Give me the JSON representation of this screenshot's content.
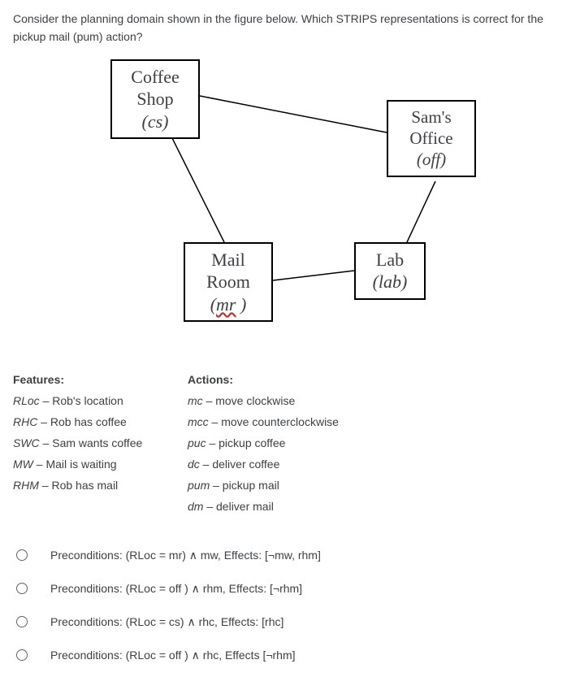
{
  "question": "Consider the planning domain shown in the figure below. Which STRIPS representations is correct for the pickup mail (pum) action?",
  "nodes": {
    "coffee": {
      "line1": "Coffee",
      "line2": "Shop",
      "line3": "(cs)"
    },
    "sam": {
      "line1": "Sam's",
      "line2": "Office",
      "line3": "(off)"
    },
    "mail": {
      "line1": "Mail",
      "line2": "Room",
      "line3_prefix": "(",
      "line3_mr": "mr",
      "line3_suffix": " )"
    },
    "lab": {
      "line1": "Lab",
      "line2": "(lab)"
    }
  },
  "features": {
    "heading": "Features:",
    "items": [
      {
        "abbr": "RLoc",
        "desc": " – Rob's location"
      },
      {
        "abbr": "RHC",
        "desc": " – Rob has coffee"
      },
      {
        "abbr": "SWC",
        "desc": " – Sam wants coffee"
      },
      {
        "abbr": "MW",
        "desc": " – Mail is waiting"
      },
      {
        "abbr": "RHM",
        "desc": " – Rob has mail"
      }
    ]
  },
  "actions": {
    "heading": "Actions:",
    "items": [
      {
        "abbr": "mc",
        "desc": " – move clockwise"
      },
      {
        "abbr": "mcc",
        "desc": " – move counterclockwise"
      },
      {
        "abbr": "puc",
        "desc": " – pickup coffee"
      },
      {
        "abbr": "dc",
        "desc": " – deliver coffee"
      },
      {
        "abbr": "pum",
        "desc": " – pickup mail"
      },
      {
        "abbr": "dm",
        "desc": " – deliver mail"
      }
    ]
  },
  "options": [
    "Preconditions: (RLoc = mr) ∧ mw, Effects: [¬mw, rhm]",
    "Preconditions: (RLoc = off ) ∧ rhm, Effects: [¬rhm]",
    "Preconditions: (RLoc = cs) ∧ rhc, Effects: [rhc]",
    "Preconditions: (RLoc = off ) ∧ rhc, Effects [¬rhm]"
  ]
}
